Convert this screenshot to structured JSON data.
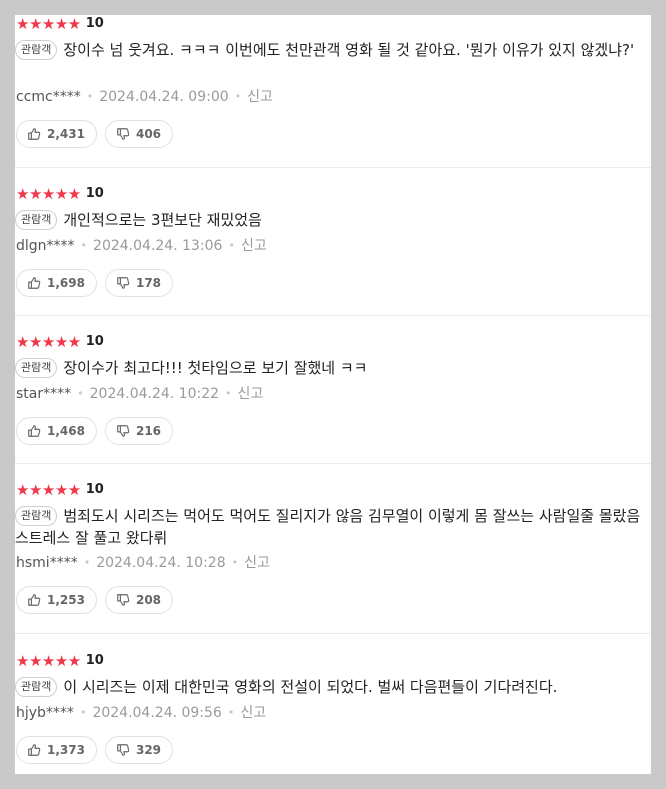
{
  "reviews": [
    {
      "stars": "★★★★★",
      "score": "10",
      "badge": "관람객",
      "text": "장이수 넘 웃겨요. ㅋㅋㅋ 이번에도 천만관객 영화 될 것 같아요. '뭔가 이유가 있지 않겠냐?'",
      "user": "ccmc****",
      "date": "2024.04.24. 09:00",
      "report": "신고",
      "likes": "2,431",
      "dislikes": "406"
    },
    {
      "stars": "★★★★★",
      "score": "10",
      "badge": "관람객",
      "text": "개인적으로는 3편보단 재밌었음",
      "user": "dlgn****",
      "date": "2024.04.24. 13:06",
      "report": "신고",
      "likes": "1,698",
      "dislikes": "178"
    },
    {
      "stars": "★★★★★",
      "score": "10",
      "badge": "관람객",
      "text": "장이수가 최고다!!! 첫타임으로 보기 잘했네 ㅋㅋ",
      "user": "star****",
      "date": "2024.04.24. 10:22",
      "report": "신고",
      "likes": "1,468",
      "dislikes": "216"
    },
    {
      "stars": "★★★★★",
      "score": "10",
      "badge": "관람객",
      "text": "범죄도시 시리즈는 먹어도 먹어도 질리지가 않음 김무열이 이렇게 몸 잘쓰는 사람일줄 몰랐음 스트레스 잘 풀고 왔다뤼",
      "user": "hsmi****",
      "date": "2024.04.24. 10:28",
      "report": "신고",
      "likes": "1,253",
      "dislikes": "208"
    },
    {
      "stars": "★★★★★",
      "score": "10",
      "badge": "관람객",
      "text": "이 시리즈는 이제 대한민국 영화의 전설이 되었다. 벌써 다음편들이 기다려진다.",
      "user": "hjyb****",
      "date": "2024.04.24. 09:56",
      "report": "신고",
      "likes": "1,373",
      "dislikes": "329"
    }
  ],
  "colors": {
    "star": "#f0384a",
    "background": "#c9c9c9",
    "panel": "#ffffff"
  },
  "icons": {
    "like": "thumbs-up-icon",
    "dislike": "thumbs-down-icon"
  }
}
